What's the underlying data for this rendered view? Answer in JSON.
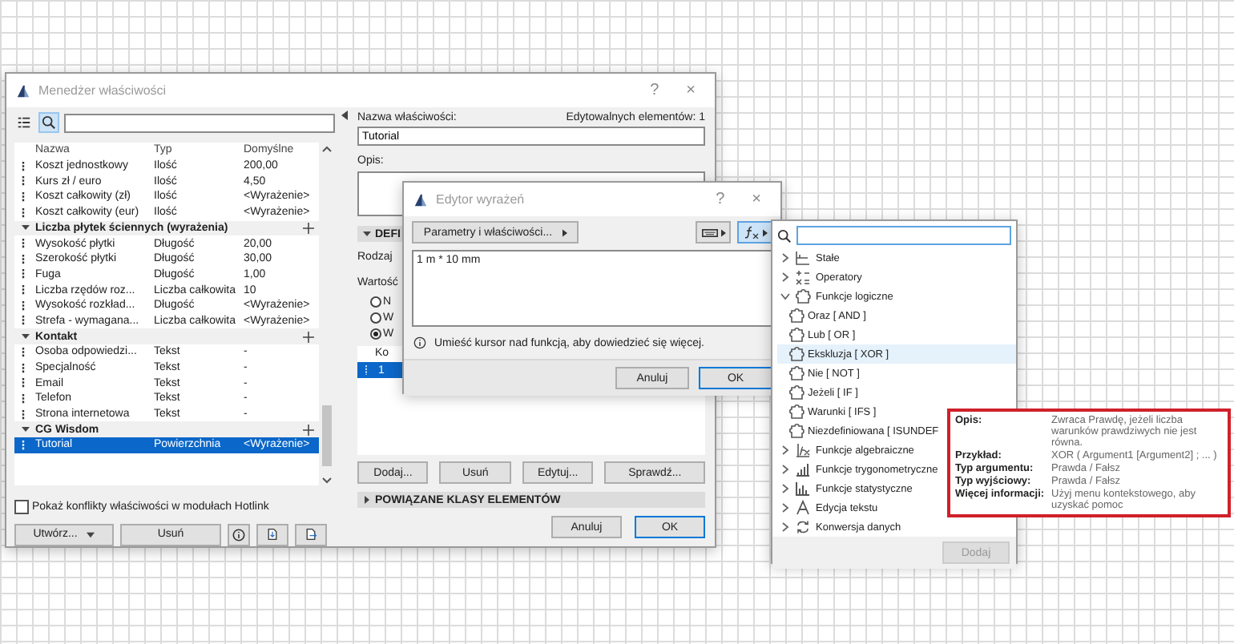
{
  "manager": {
    "title": "Menedżer właściwości",
    "help": "?",
    "close": "×",
    "columns": [
      "Nazwa",
      "Typ",
      "Domyślne"
    ],
    "rows": [
      {
        "kind": "property",
        "name": "Koszt jednostkowy",
        "type": "Ilość",
        "default": "200,00",
        "selected": false
      },
      {
        "kind": "property",
        "name": "Kurs zł / euro",
        "type": "Ilość",
        "default": "4,50",
        "selected": false
      },
      {
        "kind": "property",
        "name": "Koszt całkowity (zł)",
        "type": "Ilość",
        "default": "<Wyrażenie>",
        "selected": false
      },
      {
        "kind": "property",
        "name": "Koszt całkowity (eur)",
        "type": "Ilość",
        "default": "<Wyrażenie>",
        "selected": false
      },
      {
        "kind": "group",
        "name": "Liczba płytek ściennych (wyrażenia)",
        "expanded": true
      },
      {
        "kind": "property",
        "name": "Wysokość płytki",
        "type": "Długość",
        "default": "20,00",
        "selected": false
      },
      {
        "kind": "property",
        "name": "Szerokość płytki",
        "type": "Długość",
        "default": "30,00",
        "selected": false
      },
      {
        "kind": "property",
        "name": "Fuga",
        "type": "Długość",
        "default": "1,00",
        "selected": false
      },
      {
        "kind": "property",
        "name": "Liczba rzędów roz...",
        "type": "Liczba całkowita",
        "default": "10",
        "selected": false
      },
      {
        "kind": "property",
        "name": "Wysokość rozkład...",
        "type": "Długość",
        "default": "<Wyrażenie>",
        "selected": false
      },
      {
        "kind": "property",
        "name": "Strefa - wymagana...",
        "type": "Liczba całkowita",
        "default": "<Wyrażenie>",
        "selected": false
      },
      {
        "kind": "group",
        "name": "Kontakt",
        "expanded": true
      },
      {
        "kind": "property",
        "name": "Osoba odpowiedzi...",
        "type": "Tekst",
        "default": "-",
        "selected": false
      },
      {
        "kind": "property",
        "name": "Specjalność",
        "type": "Tekst",
        "default": "-",
        "selected": false
      },
      {
        "kind": "property",
        "name": "Email",
        "type": "Tekst",
        "default": "-",
        "selected": false
      },
      {
        "kind": "property",
        "name": "Telefon",
        "type": "Tekst",
        "default": "-",
        "selected": false
      },
      {
        "kind": "property",
        "name": "Strona internetowa",
        "type": "Tekst",
        "default": "-",
        "selected": false
      },
      {
        "kind": "group",
        "name": "CG Wisdom",
        "expanded": true
      },
      {
        "kind": "property",
        "name": "Tutorial",
        "type": "Powierzchnia",
        "default": "<Wyrażenie>",
        "selected": true
      }
    ],
    "show_conflicts": {
      "label": "Pokaż konflikty właściwości w modułach Hotlink",
      "checked": false
    },
    "create_button": "Utwórz...",
    "delete_button": "Usuń",
    "details": {
      "name_label": "Nazwa właściwości:",
      "editable_count": "Edytowalnych elementów: 1",
      "name_value": "Tutorial",
      "description_label": "Opis:",
      "definition_section": {
        "label": "DEFI",
        "expanded": true
      },
      "kind_label": "Rodzaj",
      "value_label": "Wartość",
      "options": [
        {
          "label": "N",
          "selected": false
        },
        {
          "label": "W",
          "selected": false
        },
        {
          "label": "W",
          "selected": true
        }
      ],
      "list_header": "Ko",
      "list_rows": [
        {
          "cell": "1",
          "selected": true
        }
      ],
      "list_buttons": [
        "Dodaj...",
        "Usuń",
        "Edytuj...",
        "Sprawdź..."
      ],
      "related_section": {
        "label": "POWIĄZANE KLASY ELEMENTÓW",
        "expanded": false
      },
      "footer_buttons": [
        "Anuluj",
        "OK"
      ]
    }
  },
  "editor": {
    "title": "Edytor wyrażeń",
    "help": "?",
    "close": "×",
    "params_button": "Parametry i właściwości...",
    "functions_open": true,
    "expression": "1 m * 10 mm",
    "hint": "Umieść kursor nad funkcją, aby dowiedzieć się więcej.",
    "buttons": [
      "Anuluj",
      "OK"
    ]
  },
  "functions": {
    "tree": [
      {
        "label": "Stałe",
        "expanded": false
      },
      {
        "label": "Operatory",
        "expanded": false
      },
      {
        "label": "Funkcje logiczne",
        "expanded": true,
        "children": [
          {
            "label": "Oraz [ AND ]",
            "selected": false
          },
          {
            "label": "Lub [ OR ]",
            "selected": false
          },
          {
            "label": "Ekskluzja [ XOR ]",
            "selected": true
          },
          {
            "label": "Nie [ NOT ]",
            "selected": false
          },
          {
            "label": "Jeżeli [ IF ]",
            "selected": false
          },
          {
            "label": "Warunki [ IFS ]",
            "selected": false
          },
          {
            "label": "Niezdefiniowana [ ISUNDEF",
            "selected": false
          }
        ]
      },
      {
        "label": "Funkcje algebraiczne",
        "expanded": false
      },
      {
        "label": "Funkcje trygonometryczne",
        "expanded": false
      },
      {
        "label": "Funkcje statystyczne",
        "expanded": false
      },
      {
        "label": "Edycja tekstu",
        "expanded": false
      },
      {
        "label": "Konwersja danych",
        "expanded": false
      }
    ],
    "add_button": {
      "label": "Dodaj",
      "disabled": true
    }
  },
  "tooltip": {
    "rows": [
      {
        "label": "Opis:",
        "value": "Zwraca Prawdę, jeżeli liczba warunków prawdziwych nie jest równa."
      },
      {
        "label": "Przykład:",
        "value": "XOR ( Argument1 [Argument2] ; ... )"
      },
      {
        "label": "Typ argumentu:",
        "value": "Prawda / Fałsz"
      },
      {
        "label": "Typ wyjściowy:",
        "value": "Prawda / Fałsz"
      },
      {
        "label": "Więcej informacji:",
        "value": "Użyj menu kontekstowego, aby uzyskać pomoc"
      }
    ]
  }
}
